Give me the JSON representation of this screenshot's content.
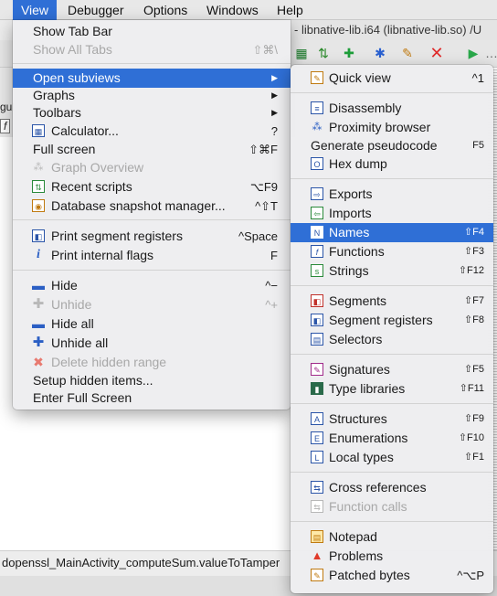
{
  "menubar": {
    "items": [
      "View",
      "Debugger",
      "Options",
      "Windows",
      "Help"
    ]
  },
  "window": {
    "title": "- libnative-lib.i64 (libnative-lib.so) /U",
    "status_text": "dopenssl_MainActivity_computeSum.valueToTamper",
    "left_labels": [
      "gul",
      "f"
    ]
  },
  "view_menu": {
    "items": [
      {
        "label": "Show Tab Bar",
        "shortcut": ""
      },
      {
        "label": "Show All Tabs",
        "shortcut": "⇧⌘\\"
      },
      {
        "label": "Open subviews",
        "shortcut": "▶"
      },
      {
        "label": "Graphs",
        "shortcut": "▶"
      },
      {
        "label": "Toolbars",
        "shortcut": "▶"
      },
      {
        "label": "Calculator...",
        "shortcut": "?"
      },
      {
        "label": "Full screen",
        "shortcut": "⇧⌘F"
      },
      {
        "label": "Graph Overview",
        "shortcut": ""
      },
      {
        "label": "Recent scripts",
        "shortcut": "⌥F9"
      },
      {
        "label": "Database snapshot manager...",
        "shortcut": "^⇧T"
      },
      {
        "label": "Print segment registers",
        "shortcut": "^Space"
      },
      {
        "label": "Print internal flags",
        "shortcut": "F"
      },
      {
        "label": "Hide",
        "shortcut": "^−"
      },
      {
        "label": "Unhide",
        "shortcut": "^+"
      },
      {
        "label": "Hide all",
        "shortcut": ""
      },
      {
        "label": "Unhide all",
        "shortcut": ""
      },
      {
        "label": "Delete hidden range",
        "shortcut": ""
      },
      {
        "label": "Setup hidden items...",
        "shortcut": ""
      },
      {
        "label": "Enter Full Screen",
        "shortcut": ""
      }
    ]
  },
  "subviews_menu": {
    "items": [
      {
        "label": "Quick view",
        "shortcut": "^1"
      },
      {
        "label": "Disassembly",
        "shortcut": ""
      },
      {
        "label": "Proximity browser",
        "shortcut": ""
      },
      {
        "label": "Generate pseudocode",
        "shortcut": "F5"
      },
      {
        "label": "Hex dump",
        "shortcut": ""
      },
      {
        "label": "Exports",
        "shortcut": ""
      },
      {
        "label": "Imports",
        "shortcut": ""
      },
      {
        "label": "Names",
        "shortcut": "⇧F4"
      },
      {
        "label": "Functions",
        "shortcut": "⇧F3"
      },
      {
        "label": "Strings",
        "shortcut": "⇧F12"
      },
      {
        "label": "Segments",
        "shortcut": "⇧F7"
      },
      {
        "label": "Segment registers",
        "shortcut": "⇧F8"
      },
      {
        "label": "Selectors",
        "shortcut": ""
      },
      {
        "label": "Signatures",
        "shortcut": "⇧F5"
      },
      {
        "label": "Type libraries",
        "shortcut": "⇧F11"
      },
      {
        "label": "Structures",
        "shortcut": "⇧F9"
      },
      {
        "label": "Enumerations",
        "shortcut": "⇧F10"
      },
      {
        "label": "Local types",
        "shortcut": "⇧F1"
      },
      {
        "label": "Cross references",
        "shortcut": ""
      },
      {
        "label": "Function calls",
        "shortcut": ""
      },
      {
        "label": "Notepad",
        "shortcut": ""
      },
      {
        "label": "Problems",
        "shortcut": ""
      },
      {
        "label": "Patched bytes",
        "shortcut": "^⌥P"
      }
    ]
  },
  "colors": {
    "highlight": "#2f6fd6",
    "disabled": "#a8a8a8"
  }
}
